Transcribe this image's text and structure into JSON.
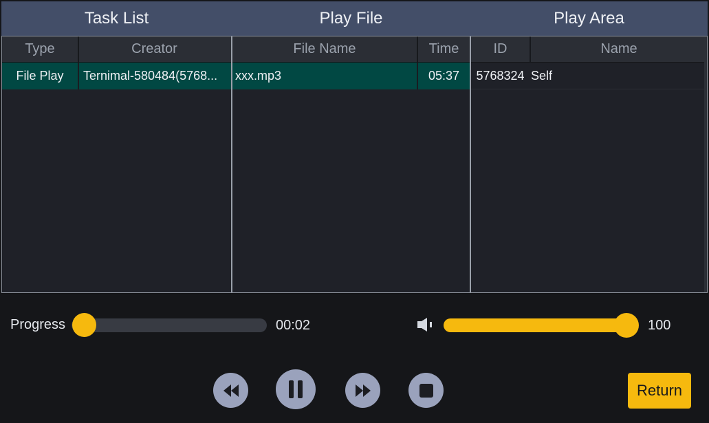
{
  "header": {
    "task_list": "Task List",
    "play_file": "Play File",
    "play_area": "Play Area"
  },
  "task_list": {
    "columns": [
      "Type",
      "Creator"
    ],
    "rows": [
      {
        "type": "File Play",
        "creator": "Ternimal-580484(5768..."
      }
    ]
  },
  "play_file": {
    "columns": [
      "File Name",
      "Time"
    ],
    "rows": [
      {
        "name": "xxx.mp3",
        "time": "05:37"
      }
    ]
  },
  "play_area": {
    "columns": [
      "ID",
      "Name"
    ],
    "rows": [
      {
        "id": "5768324",
        "name": "Self"
      }
    ]
  },
  "controls": {
    "progress_label": "Progress",
    "progress_time": "00:02",
    "progress_fraction": 0.0,
    "volume_value": "100",
    "volume_fraction": 1.0,
    "return_label": "Return",
    "icons": [
      "rewind-icon",
      "pause-icon",
      "fast-forward-icon",
      "stop-icon",
      "speaker-icon"
    ]
  },
  "colors": {
    "header": "#434e68",
    "selected_row": "#014843",
    "accent": "#f6b90e",
    "control_button": "#9aa2bc"
  }
}
